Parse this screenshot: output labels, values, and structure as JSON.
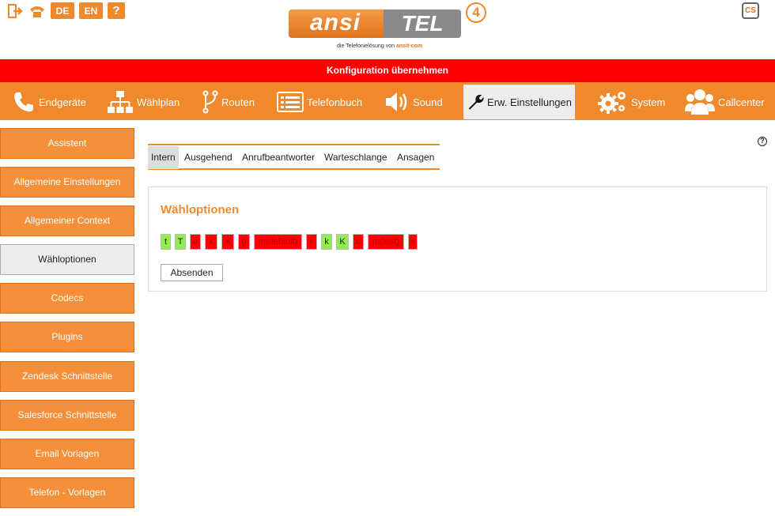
{
  "header": {
    "languages": [
      "DE",
      "EN"
    ],
    "help_glyph": "?",
    "logo": {
      "left": "ansi",
      "right": "TEL",
      "version": "4",
      "tagline": "die Telefonielösung von",
      "tagline_brand": "ansit·com"
    },
    "cs_icon_text": "CS",
    "icons": [
      "logout-icon",
      "phone-icon",
      "cs-icon"
    ]
  },
  "apply_bar": {
    "label": "Konfiguration übernehmen",
    "color": "#ff0000"
  },
  "main_nav": {
    "items": [
      {
        "label": "Endgeräte",
        "icon": "phone-icon"
      },
      {
        "label": "Wählplan",
        "icon": "sitemap-icon"
      },
      {
        "label": "Routen",
        "icon": "route-icon"
      },
      {
        "label": "Telefonbuch",
        "icon": "phonebook-icon"
      },
      {
        "label": "Sound",
        "icon": "speaker-icon"
      },
      {
        "label": "Erw. Einstellungen",
        "icon": "wrench-icon",
        "active": true
      },
      {
        "label": "System",
        "icon": "gears-icon"
      },
      {
        "label": "Callcenter",
        "icon": "users-icon"
      }
    ],
    "accent": "#f0892c"
  },
  "sidebar": {
    "items": [
      {
        "label": "Assistent"
      },
      {
        "label": "Allgemeine Einstellungen"
      },
      {
        "label": "Allgemeiner Context"
      },
      {
        "label": "Wähloptionen",
        "active": true
      },
      {
        "label": "Codecs"
      },
      {
        "label": "Plugins"
      },
      {
        "label": "Zendesk Schnittstelle"
      },
      {
        "label": "Salesforce Schnittstelle"
      },
      {
        "label": "Email Vorlagen"
      },
      {
        "label": "Telefon - Vorlagen"
      }
    ]
  },
  "content": {
    "help_glyph": "?",
    "tabs": [
      {
        "label": "Intern",
        "active": true
      },
      {
        "label": "Ausgehend"
      },
      {
        "label": "Anrufbeantworter"
      },
      {
        "label": "Warteschlange"
      },
      {
        "label": "Ansagen"
      }
    ],
    "panel": {
      "title": "Wähloptionen",
      "options": [
        {
          "label": "t",
          "enabled": true
        },
        {
          "label": "T",
          "enabled": true
        },
        {
          "label": "o",
          "enabled": false
        },
        {
          "label": "x",
          "enabled": false
        },
        {
          "label": "X",
          "enabled": false
        },
        {
          "label": "g",
          "enabled": false
        },
        {
          "label": "m(default)",
          "enabled": false
        },
        {
          "label": "r",
          "enabled": false
        },
        {
          "label": "k",
          "enabled": true
        },
        {
          "label": "K",
          "enabled": true
        },
        {
          "label": "c",
          "enabled": false
        },
        {
          "label": "m(test)",
          "enabled": false
        },
        {
          "label": "i",
          "enabled": false
        }
      ],
      "submit_label": "Absenden"
    },
    "colors": {
      "enabled": "#90ee50",
      "disabled": "#ff0000",
      "title": "#f0892c"
    }
  }
}
